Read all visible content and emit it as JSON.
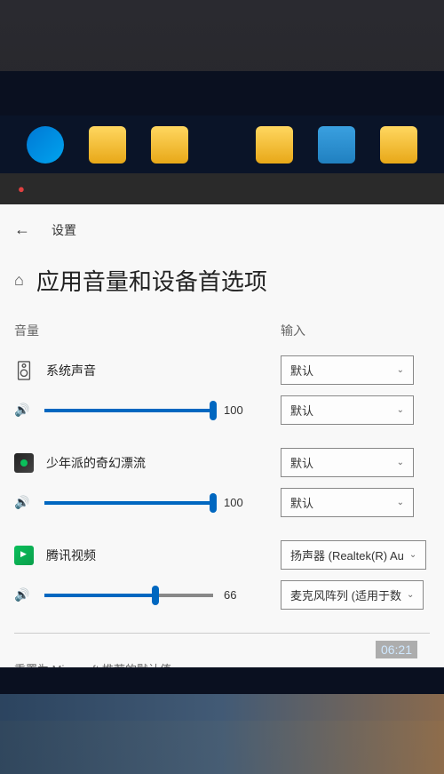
{
  "breadcrumb": "设置",
  "page_title": "应用音量和设备首选项",
  "columns": {
    "volume": "音量",
    "input": "输入"
  },
  "apps": [
    {
      "name": "系统声音",
      "volume": 100,
      "output": "默认",
      "input": "默认",
      "icon": "system"
    },
    {
      "name": "少年派的奇幻漂流",
      "volume": 100,
      "output": "默认",
      "input": "默认",
      "icon": "media"
    },
    {
      "name": "腾讯视频",
      "volume": 66,
      "output": "扬声器 (Realtek(R) Au",
      "input": "麦克风阵列 (适用于数",
      "icon": "tencent"
    }
  ],
  "reset_text": "重置为 Microsoft 推荐的默认值。",
  "clock": "06:21"
}
